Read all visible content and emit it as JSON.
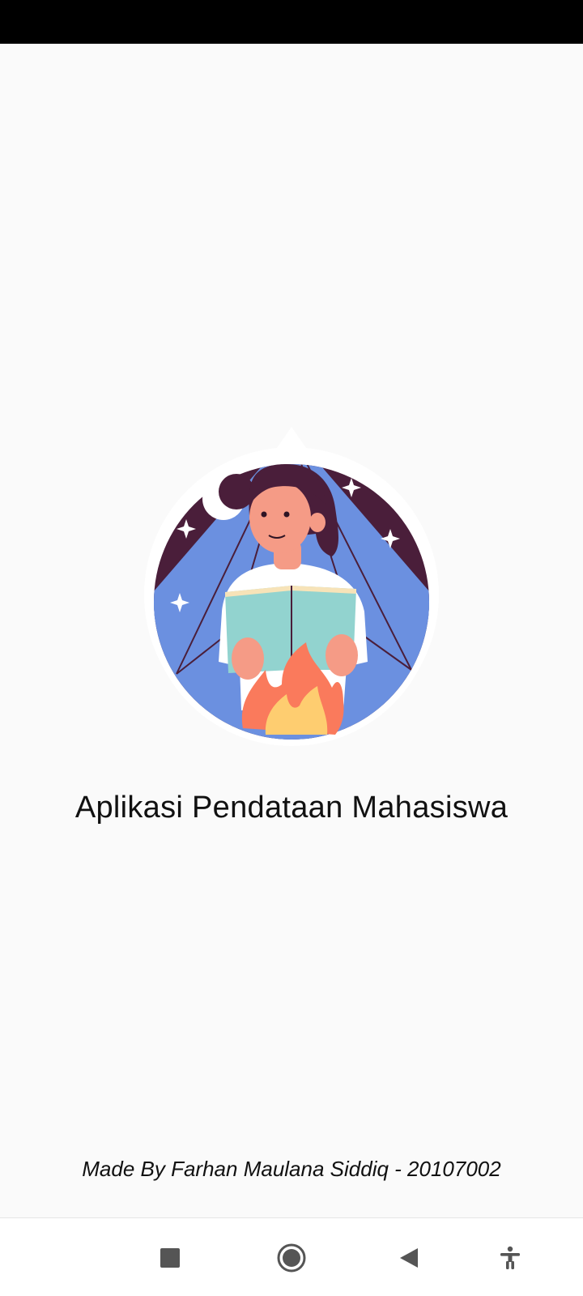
{
  "splash": {
    "title": "Aplikasi Pendataan Mahasiswa",
    "credit": "Made By Farhan Maulana Siddiq - 20107002"
  },
  "icons": {
    "illustration": "student-reading-book-illustration",
    "nav_recents": "square-recents-icon",
    "nav_home": "circle-home-icon",
    "nav_back": "triangle-back-icon",
    "nav_accessibility": "accessibility-person-icon"
  },
  "colors": {
    "background": "#fafafa",
    "status_bar": "#000000",
    "night_sky": "#4a1e3a",
    "tent_blue": "#6b90e0",
    "book": "#92d3cf",
    "skin": "#f59b86",
    "fire_outer": "#fa7a5c",
    "fire_inner": "#fecd70",
    "nav_icon": "#555555"
  }
}
